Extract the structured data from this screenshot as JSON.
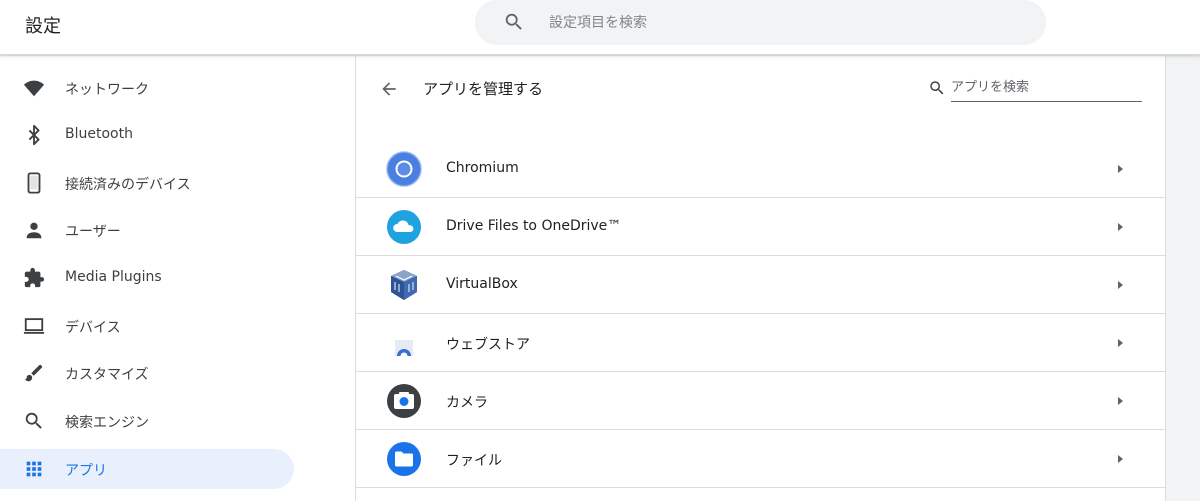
{
  "header": {
    "title": "設定",
    "search_placeholder": "設定項目を検索"
  },
  "sidebar": {
    "items": [
      {
        "label": "ネットワーク",
        "icon": "wifi-icon"
      },
      {
        "label": "Bluetooth",
        "icon": "bluetooth-icon"
      },
      {
        "label": "接続済みのデバイス",
        "icon": "phone-icon"
      },
      {
        "label": "ユーザー",
        "icon": "person-icon"
      },
      {
        "label": "Media Plugins",
        "icon": "puzzle-icon"
      },
      {
        "label": "デバイス",
        "icon": "laptop-icon"
      },
      {
        "label": "カスタマイズ",
        "icon": "brush-icon"
      },
      {
        "label": "検索エンジン",
        "icon": "search-icon"
      },
      {
        "label": "アプリ",
        "icon": "apps-grid-icon",
        "active": true
      }
    ]
  },
  "main": {
    "page_title": "アプリを管理する",
    "search_placeholder": "アプリを検索",
    "apps": [
      {
        "name": "Chromium",
        "icon": "chromium-icon"
      },
      {
        "name": "Drive Files to OneDrive™",
        "icon": "onedrive-cloud-icon"
      },
      {
        "name": "VirtualBox",
        "icon": "virtualbox-icon"
      },
      {
        "name": "ウェブストア",
        "icon": "webstore-icon"
      },
      {
        "name": "カメラ",
        "icon": "camera-icon"
      },
      {
        "name": "ファイル",
        "icon": "files-folder-icon"
      }
    ]
  },
  "colors": {
    "accent": "#1a73e8",
    "active_bg": "#e8f0fe",
    "icon_gray": "#5f6368",
    "divider": "#dadce0",
    "app_bg": "#f1f3f4"
  }
}
